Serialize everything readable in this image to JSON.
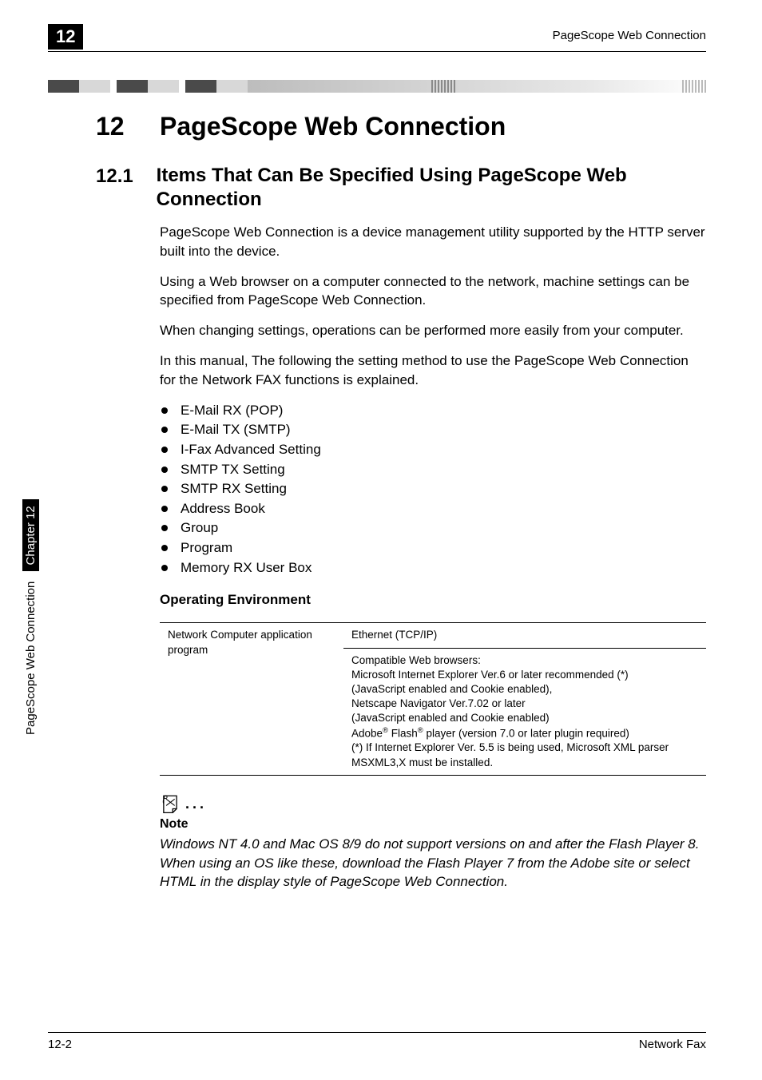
{
  "header": {
    "chapter_badge": "12",
    "running_header": "PageScope Web Connection"
  },
  "h1": {
    "num": "12",
    "title": "PageScope Web Connection"
  },
  "h2": {
    "num": "12.1",
    "title": "Items That Can Be Specified Using PageScope Web Connection"
  },
  "paras": [
    "PageScope Web Connection is a device management utility supported by the HTTP server built into the device.",
    "Using a Web browser on a computer connected to the network, machine settings can be specified from PageScope Web Connection.",
    "When changing settings, operations can be performed more easily from your computer.",
    "In this manual, The following the setting method to use the PageScope Web Connection for the Network FAX functions is explained."
  ],
  "bullets": [
    "E-Mail RX (POP)",
    "E-Mail TX (SMTP)",
    "I-Fax Advanced Setting",
    "SMTP TX Setting",
    "SMTP RX Setting",
    "Address Book",
    "Group",
    "Program",
    "Memory RX User Box"
  ],
  "subhead": "Operating Environment",
  "table": {
    "left_label": "Network Computer application program",
    "right_row1": "Ethernet (TCP/IP)",
    "right_row2_html": "Compatible Web browsers:<br>Microsoft Internet Explorer Ver.6 or later recommended (*)<br>(JavaScript enabled and Cookie enabled),<br>Netscape Navigator Ver.7.02 or later<br>(JavaScript enabled and Cookie enabled)<br>Adobe<sup>®</sup> Flash<sup>®</sup> player (version 7.0 or later plugin required)<br>(*) If Internet Explorer Ver. 5.5 is being used, Microsoft XML parser MSXML3,X must be installed."
  },
  "note": {
    "dots": "...",
    "head": "Note",
    "body": "Windows NT 4.0 and Mac OS 8/9 do not support versions on and after the Flash Player 8. When using an OS like these, download the Flash Player 7 from the Adobe site or select HTML in the display style of PageScope Web Connection."
  },
  "side": {
    "text": "PageScope Web Connection",
    "chapter": "Chapter 12"
  },
  "footer": {
    "page": "12-2",
    "doc": "Network Fax"
  }
}
